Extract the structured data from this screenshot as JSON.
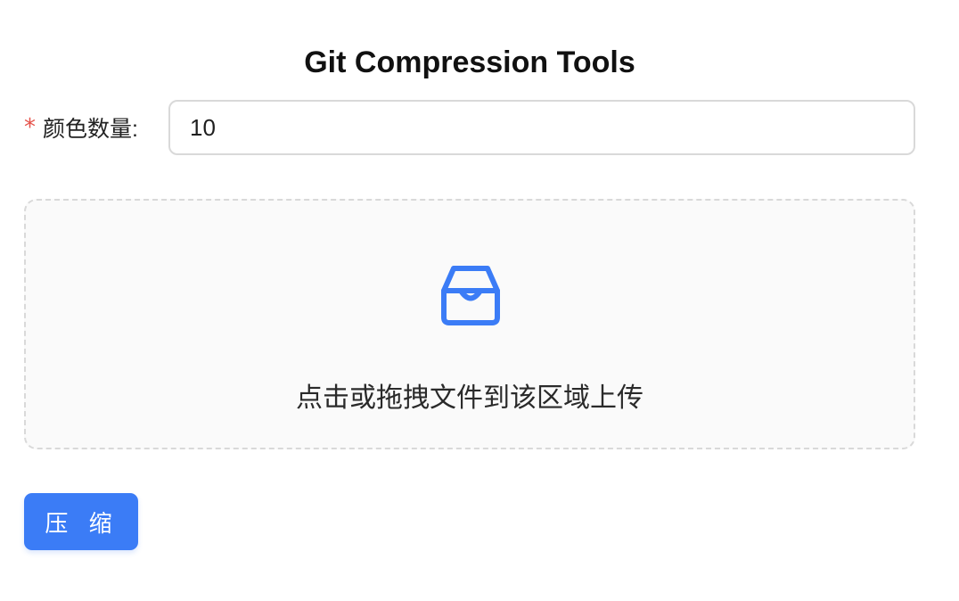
{
  "app": {
    "title": "Git Compression Tools"
  },
  "form": {
    "colors_count": {
      "required_mark": "*",
      "label": "颜色数量:",
      "value": "10"
    }
  },
  "upload": {
    "icon": "inbox-icon",
    "text": "点击或拖拽文件到该区域上传"
  },
  "actions": {
    "compress_label": "压 缩"
  },
  "colors": {
    "accent": "#3b7cf6",
    "required": "#e5534b"
  }
}
